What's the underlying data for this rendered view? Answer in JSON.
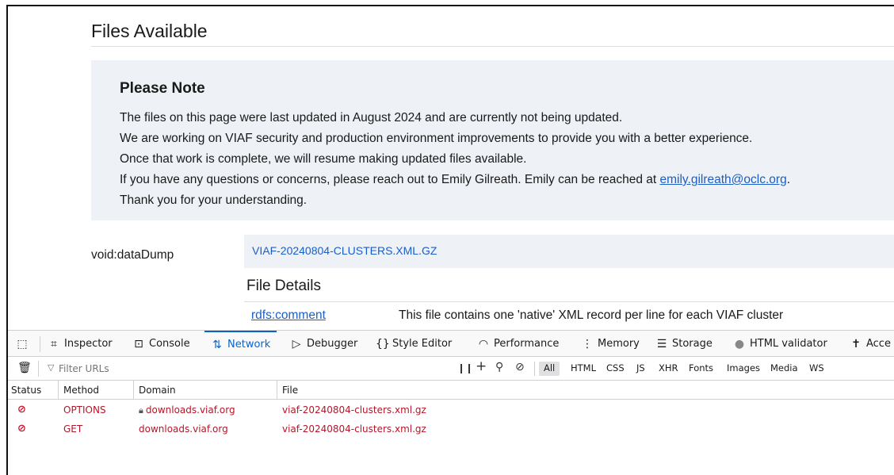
{
  "page": {
    "title": "Files Available",
    "note": {
      "heading": "Please Note",
      "lines": [
        "The files on this page were last updated in August 2024 and are currently not being updated.",
        "We are working on VIAF security and production environment improvements to provide you with a better experience.",
        "Once that work is complete, we will resume making updated files available.",
        "If you have any questions or concerns, please reach out to Emily Gilreath. Emily can be reached at ",
        "Thank you for your understanding."
      ],
      "email": "emily.gilreath@oclc.org",
      "email_suffix": "."
    },
    "dump_label": "void:dataDump",
    "dump_link": "VIAF-20240804-CLUSTERS.XML.GZ",
    "details_heading": "File Details",
    "comment_key": "rdfs:comment",
    "comment_value": "This file contains one 'native' XML record per line for each VIAF cluster"
  },
  "devtools": {
    "tabs": [
      {
        "label": "Inspector",
        "icon": "inspector-icon"
      },
      {
        "label": "Console",
        "icon": "console-icon"
      },
      {
        "label": "Network",
        "icon": "network-icon",
        "active": true
      },
      {
        "label": "Debugger",
        "icon": "debugger-icon"
      },
      {
        "label": "Style Editor",
        "icon": "style-editor-icon"
      },
      {
        "label": "Performance",
        "icon": "performance-icon"
      },
      {
        "label": "Memory",
        "icon": "memory-icon"
      },
      {
        "label": "Storage",
        "icon": "storage-icon"
      },
      {
        "label": "HTML validator",
        "icon": "html-validator-icon"
      },
      {
        "label": "Acce",
        "icon": "accessibility-icon"
      }
    ],
    "filter_placeholder": "Filter URLs",
    "type_filters": [
      "All",
      "HTML",
      "CSS",
      "JS",
      "XHR",
      "Fonts",
      "Images",
      "Media",
      "WS"
    ],
    "active_type": "All",
    "columns": [
      "Status",
      "Method",
      "Domain",
      "File"
    ],
    "requests": [
      {
        "status": "blocked-icon",
        "method": "OPTIONS",
        "domain": "downloads.viaf.org",
        "secure": true,
        "file": "viaf-20240804-clusters.xml.gz"
      },
      {
        "status": "blocked-icon",
        "method": "GET",
        "domain": "downloads.viaf.org",
        "secure": false,
        "file": "viaf-20240804-clusters.xml.gz"
      }
    ],
    "colors": {
      "accent": "#0b63c9",
      "error": "#b3172a"
    }
  }
}
